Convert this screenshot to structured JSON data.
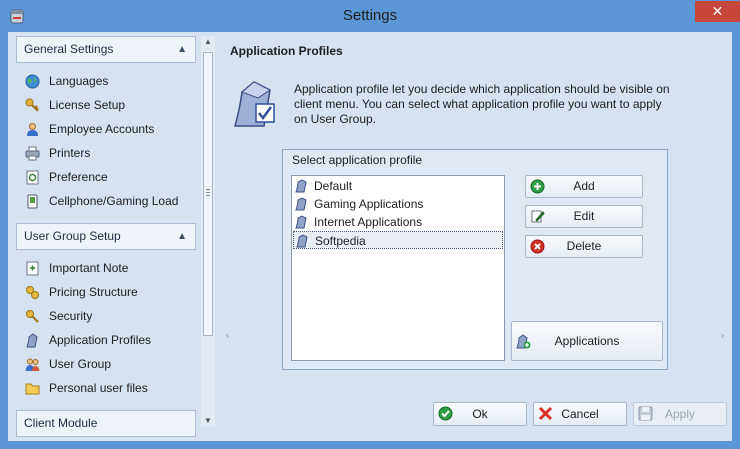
{
  "window": {
    "title": "Settings",
    "close_glyph": "✕"
  },
  "sidebar": {
    "groups": [
      {
        "title": "General Settings",
        "items": [
          {
            "label": "Languages",
            "icon": "globe-icon"
          },
          {
            "label": "License Setup",
            "icon": "key-icon"
          },
          {
            "label": "Employee Accounts",
            "icon": "user-icon"
          },
          {
            "label": "Printers",
            "icon": "printer-icon"
          },
          {
            "label": "Preference",
            "icon": "preference-icon"
          },
          {
            "label": "Cellphone/Gaming Load",
            "icon": "cellphone-icon"
          }
        ]
      },
      {
        "title": "User Group Setup",
        "items": [
          {
            "label": "Important Note",
            "icon": "note-icon"
          },
          {
            "label": "Pricing Structure",
            "icon": "pricing-icon"
          },
          {
            "label": "Security",
            "icon": "security-icon"
          },
          {
            "label": "Application Profiles",
            "icon": "profile-icon"
          },
          {
            "label": "User Group",
            "icon": "user-group-icon"
          },
          {
            "label": "Personal user files",
            "icon": "folder-icon"
          }
        ]
      },
      {
        "title": "Client Module",
        "items": []
      }
    ]
  },
  "main": {
    "heading": "Application Profiles",
    "description": "Application profile let you decide which application should be visible on client menu. You can select what application profile you want to apply on User Group.",
    "select_box": {
      "title": "Select application profile",
      "profiles": [
        "Default",
        "Gaming Applications",
        "Internet Applications",
        "Softpedia"
      ],
      "selected": "Softpedia"
    },
    "buttons": {
      "add": "Add",
      "edit": "Edit",
      "delete": "Delete",
      "applications": "Applications"
    }
  },
  "footer": {
    "ok": "Ok",
    "cancel": "Cancel",
    "apply": "Apply"
  },
  "colors": {
    "window_frame": "#5b97d6",
    "panel_bg": "#d6e2f0",
    "close_button": "#c7463c",
    "add_icon": "#2ea043",
    "delete_icon": "#d93025"
  }
}
